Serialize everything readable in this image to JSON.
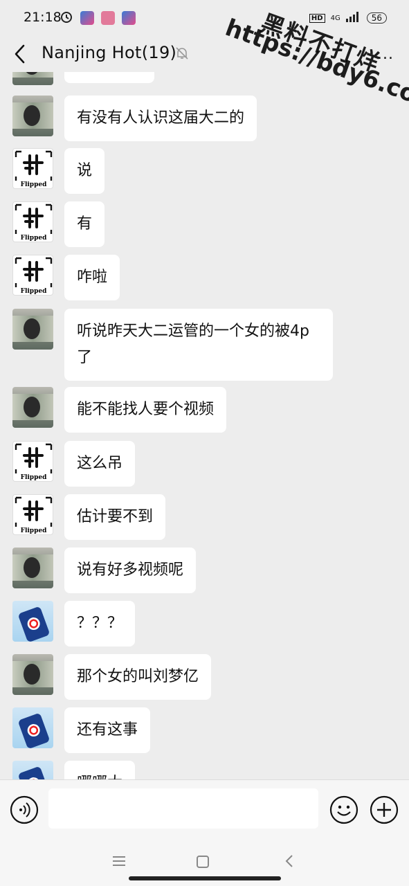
{
  "status_bar": {
    "time": "21:18",
    "hd": "HD",
    "network": "4G",
    "battery": "56"
  },
  "header": {
    "title": "Nanjing Hot(19)",
    "more": "..."
  },
  "watermark": {
    "line1": "黑料不打烊",
    "line2": "https://bdy6.co"
  },
  "messages": [
    {
      "avatar": "money",
      "text": "有没有人认识这届大二的"
    },
    {
      "avatar": "flipped",
      "text": "说"
    },
    {
      "avatar": "flipped",
      "text": "有"
    },
    {
      "avatar": "flipped",
      "text": "咋啦"
    },
    {
      "avatar": "money",
      "text": "听说昨天大二运管的一个女的被4p 了"
    },
    {
      "avatar": "money",
      "text": "能不能找人要个视频"
    },
    {
      "avatar": "flipped",
      "text": "这么吊"
    },
    {
      "avatar": "flipped",
      "text": "估计要不到"
    },
    {
      "avatar": "money",
      "text": "说有好多视频呢"
    },
    {
      "avatar": "can",
      "text": "？？？"
    },
    {
      "avatar": "money",
      "text": "那个女的叫刘梦亿"
    },
    {
      "avatar": "can",
      "text": "还有这事"
    },
    {
      "avatar": "can",
      "text": "哪哪大"
    }
  ],
  "avatar_label": "Flipped"
}
